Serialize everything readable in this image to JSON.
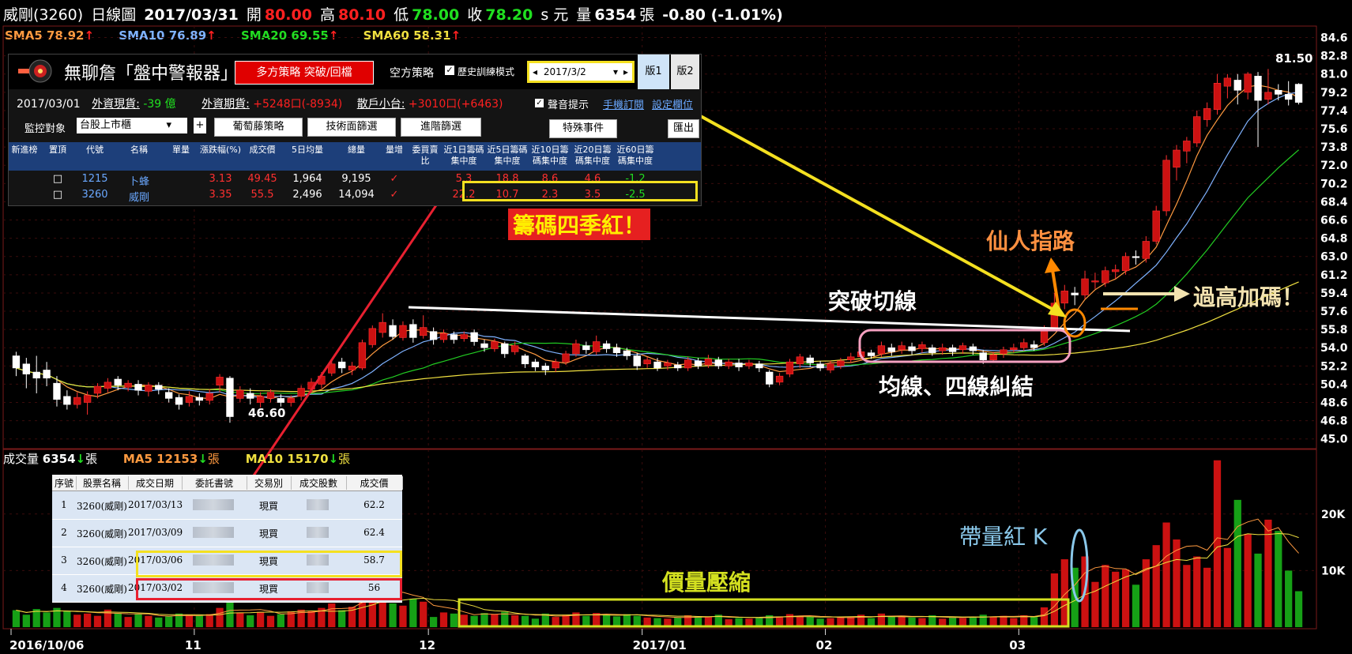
{
  "header": {
    "stock": "威剛(3260)",
    "period": "日線圖",
    "date": "2017/03/31",
    "open_label": "開",
    "open": "80.00",
    "high_label": "高",
    "high": "80.10",
    "low_label": "低",
    "low": "78.00",
    "close_label": "收",
    "close": "78.20",
    "unit": "s 元",
    "vol_label": "量",
    "vol": "6354",
    "vol_unit": "張",
    "change": "-0.80 (-1.01%)"
  },
  "sma": {
    "sma5": "SMA5 78.92",
    "sma10": "SMA10 76.89",
    "sma20": "SMA20 69.55",
    "sma60": "SMA60 58.31",
    "arrow": "↑"
  },
  "volume_bar": {
    "label": "成交量",
    "value": "6354",
    "unit": "張",
    "ma5": "MA5 12153",
    "ma10": "MA10 15170",
    "arrow": "↓"
  },
  "panel": {
    "title": "無聊詹「盤中警報器」",
    "long_btn": "多方策略 突破/回檔",
    "short_label": "空方策略",
    "history_label": "歷史訓練模式",
    "date_value": "2017/3/2",
    "tab1": "版1",
    "tab2": "版2",
    "date": "2017/03/01",
    "foreign_spot_label": "外資現貨:",
    "foreign_spot": "-39 億",
    "foreign_fut_label": "外資期貨:",
    "foreign_fut": "+5248口(-8934)",
    "retail_label": "散戶小台:",
    "retail": "+3010口(+6463)",
    "sound_label": "聲音提示",
    "mobile_link": "手機訂閱",
    "settings_link": "設定欄位",
    "monitor_label": "監控對象",
    "monitor_value": "台股上市櫃",
    "btn_grape": "葡萄藤策略",
    "btn_tech": "技術面篩選",
    "btn_adv": "進階篩選",
    "btn_special": "特殊事件",
    "btn_export": "匯出",
    "columns": [
      "新進榜",
      "置頂",
      "代號",
      "名稱",
      "單量",
      "漲跌幅(%)",
      "成交價",
      "5日均量",
      "總量",
      "量增",
      "委買賣比",
      "近1日籌碼集中度",
      "近5日籌碼集中度",
      "近10日籌碼集中度",
      "近20日籌碼集中度",
      "近60日籌碼集中度"
    ],
    "rows": [
      {
        "code": "1215",
        "name": "卜蜂",
        "chg": "3.13",
        "price": "49.45",
        "avg5": "1,964",
        "total": "9,195",
        "c1": "5.3",
        "c5": "18.8",
        "c10": "8.6",
        "c20": "4.6",
        "c60": "-1.2"
      },
      {
        "code": "3260",
        "name": "威剛",
        "chg": "3.35",
        "price": "55.5",
        "avg5": "2,496",
        "total": "14,094",
        "c1": "22.2",
        "c5": "10.7",
        "c10": "2.3",
        "c20": "3.5",
        "c60": "-2.5"
      }
    ],
    "check": "✓"
  },
  "trades": {
    "columns": [
      "序號",
      "股票名稱",
      "成交日期",
      "委託書號",
      "交易別",
      "成交股數",
      "成交價"
    ],
    "rows": [
      {
        "no": "1",
        "name": "3260(威剛)",
        "date": "2017/03/13",
        "type": "現買",
        "price": "62.2"
      },
      {
        "no": "2",
        "name": "3260(威剛)",
        "date": "2017/03/09",
        "type": "現買",
        "price": "62.4"
      },
      {
        "no": "3",
        "name": "3260(威剛)",
        "date": "2017/03/06",
        "type": "現買",
        "price": "58.7"
      },
      {
        "no": "4",
        "name": "3260(威剛)",
        "date": "2017/03/02",
        "type": "現買",
        "price": "56"
      }
    ]
  },
  "annotations": {
    "chips_red": "籌碼四季紅！",
    "guide": "仙人指路",
    "breakout": "突破切線",
    "add": "過高加碼！",
    "tangle": "均線、四線糾結",
    "volume_red_k": "帶量紅 K",
    "compress": "價量壓縮",
    "low_price": "46.60",
    "high_price": "81.50"
  },
  "chart_data": {
    "type": "candlestick",
    "price_axis": [
      "84.6",
      "82.8",
      "81.0",
      "79.2",
      "77.4",
      "75.6",
      "73.8",
      "72.0",
      "70.2",
      "68.4",
      "66.6",
      "64.8",
      "63.0",
      "61.2",
      "59.4",
      "57.6",
      "55.8",
      "54.0",
      "52.2",
      "50.4",
      "48.6",
      "46.8",
      "45.0"
    ],
    "ylim": [
      44.2,
      85.5
    ],
    "volume_axis": [
      {
        "label": "20K",
        "value": 20000
      },
      {
        "label": "10K",
        "value": 10000
      }
    ],
    "x_ticks": [
      {
        "label": "2016/10/06",
        "index": 0
      },
      {
        "label": "11",
        "index": 18
      },
      {
        "label": "12",
        "index": 41
      },
      {
        "label": "2017/01",
        "index": 62
      },
      {
        "label": "02",
        "index": 80
      },
      {
        "label": "03",
        "index": 99
      }
    ],
    "candles": [
      {
        "o": 53.2,
        "c": 52.0,
        "h": 53.6,
        "l": 51.2,
        "v": 3000
      },
      {
        "o": 52.4,
        "c": 51.4,
        "h": 53.0,
        "l": 50.0,
        "v": 2200
      },
      {
        "o": 51.6,
        "c": 51.0,
        "h": 53.2,
        "l": 49.5,
        "v": 3200
      },
      {
        "o": 51.8,
        "c": 51.0,
        "h": 52.6,
        "l": 50.2,
        "v": 2600
      },
      {
        "o": 50.5,
        "c": 48.9,
        "h": 51.2,
        "l": 48.2,
        "v": 3400
      },
      {
        "o": 49.2,
        "c": 48.4,
        "h": 49.8,
        "l": 47.9,
        "v": 2800
      },
      {
        "o": 48.4,
        "c": 49.1,
        "h": 49.6,
        "l": 48.0,
        "v": 2200
      },
      {
        "o": 48.6,
        "c": 49.3,
        "h": 49.7,
        "l": 47.4,
        "v": 2400
      },
      {
        "o": 49.5,
        "c": 50.2,
        "h": 50.5,
        "l": 49.0,
        "v": 2000
      },
      {
        "o": 50.0,
        "c": 50.6,
        "h": 51.0,
        "l": 49.6,
        "v": 3100
      },
      {
        "o": 50.9,
        "c": 50.3,
        "h": 51.2,
        "l": 49.8,
        "v": 2500
      },
      {
        "o": 50.1,
        "c": 50.5,
        "h": 50.8,
        "l": 49.7,
        "v": 1800
      },
      {
        "o": 50.4,
        "c": 49.8,
        "h": 50.8,
        "l": 49.3,
        "v": 2300
      },
      {
        "o": 49.7,
        "c": 50.3,
        "h": 50.6,
        "l": 49.2,
        "v": 2000
      },
      {
        "o": 50.3,
        "c": 49.9,
        "h": 50.6,
        "l": 49.4,
        "v": 1700
      },
      {
        "o": 49.6,
        "c": 49.0,
        "h": 50.0,
        "l": 48.6,
        "v": 1900
      },
      {
        "o": 49.1,
        "c": 48.4,
        "h": 49.4,
        "l": 47.9,
        "v": 2400
      },
      {
        "o": 48.6,
        "c": 49.2,
        "h": 49.7,
        "l": 48.2,
        "v": 2200
      },
      {
        "o": 49.1,
        "c": 48.8,
        "h": 49.5,
        "l": 48.3,
        "v": 2000
      },
      {
        "o": 48.8,
        "c": 49.5,
        "h": 49.9,
        "l": 48.4,
        "v": 2300
      },
      {
        "o": 50.3,
        "c": 51.1,
        "h": 51.4,
        "l": 49.6,
        "v": 3400
      },
      {
        "o": 51.0,
        "c": 47.2,
        "h": 51.2,
        "l": 46.6,
        "v": 4800
      },
      {
        "o": 49.0,
        "c": 49.8,
        "h": 50.2,
        "l": 48.6,
        "v": 2600
      },
      {
        "o": 49.5,
        "c": 49.0,
        "h": 50.0,
        "l": 48.4,
        "v": 2100
      },
      {
        "o": 48.6,
        "c": 49.2,
        "h": 49.6,
        "l": 48.1,
        "v": 2700
      },
      {
        "o": 49.0,
        "c": 49.6,
        "h": 49.9,
        "l": 48.6,
        "v": 2000
      },
      {
        "o": 49.0,
        "c": 48.6,
        "h": 49.4,
        "l": 48.2,
        "v": 2300
      },
      {
        "o": 48.6,
        "c": 49.0,
        "h": 49.3,
        "l": 48.2,
        "v": 2800
      },
      {
        "o": 49.2,
        "c": 50.0,
        "h": 50.3,
        "l": 48.8,
        "v": 3100
      },
      {
        "o": 49.9,
        "c": 50.6,
        "h": 51.0,
        "l": 49.6,
        "v": 2800
      },
      {
        "o": 50.4,
        "c": 51.2,
        "h": 51.6,
        "l": 50.0,
        "v": 3400
      },
      {
        "o": 51.5,
        "c": 52.4,
        "h": 52.8,
        "l": 51.2,
        "v": 4200
      },
      {
        "o": 52.6,
        "c": 52.0,
        "h": 53.0,
        "l": 51.5,
        "v": 3000
      },
      {
        "o": 51.8,
        "c": 52.2,
        "h": 52.6,
        "l": 51.3,
        "v": 3600
      },
      {
        "o": 52.0,
        "c": 54.5,
        "h": 54.8,
        "l": 51.8,
        "v": 7500
      },
      {
        "o": 54.3,
        "c": 55.9,
        "h": 56.2,
        "l": 54.0,
        "v": 6500
      },
      {
        "o": 55.5,
        "c": 56.5,
        "h": 57.4,
        "l": 55.0,
        "v": 8800
      },
      {
        "o": 56.2,
        "c": 55.1,
        "h": 56.8,
        "l": 54.8,
        "v": 4200
      },
      {
        "o": 55.0,
        "c": 56.2,
        "h": 56.6,
        "l": 54.7,
        "v": 3800
      },
      {
        "o": 56.3,
        "c": 55.0,
        "h": 56.8,
        "l": 54.5,
        "v": 5000
      },
      {
        "o": 55.2,
        "c": 56.0,
        "h": 57.2,
        "l": 54.9,
        "v": 4500
      },
      {
        "o": 55.6,
        "c": 54.8,
        "h": 56.0,
        "l": 54.3,
        "v": 1800
      },
      {
        "o": 54.8,
        "c": 55.4,
        "h": 55.8,
        "l": 54.5,
        "v": 2600
      },
      {
        "o": 55.3,
        "c": 54.8,
        "h": 55.6,
        "l": 54.4,
        "v": 2400
      },
      {
        "o": 54.9,
        "c": 55.3,
        "h": 55.6,
        "l": 54.6,
        "v": 2200
      },
      {
        "o": 55.5,
        "c": 54.6,
        "h": 55.8,
        "l": 54.2,
        "v": 2000
      },
      {
        "o": 54.4,
        "c": 54.0,
        "h": 54.8,
        "l": 53.6,
        "v": 2500
      },
      {
        "o": 53.9,
        "c": 54.6,
        "h": 54.9,
        "l": 53.6,
        "v": 2300
      },
      {
        "o": 54.4,
        "c": 53.4,
        "h": 54.6,
        "l": 53.0,
        "v": 2700
      },
      {
        "o": 53.6,
        "c": 54.2,
        "h": 54.6,
        "l": 53.3,
        "v": 2100
      },
      {
        "o": 53.2,
        "c": 52.4,
        "h": 53.4,
        "l": 52.0,
        "v": 2000
      },
      {
        "o": 52.6,
        "c": 52.1,
        "h": 52.9,
        "l": 51.7,
        "v": 1500
      },
      {
        "o": 52.2,
        "c": 51.8,
        "h": 52.5,
        "l": 51.3,
        "v": 2400
      },
      {
        "o": 52.0,
        "c": 52.6,
        "h": 52.9,
        "l": 51.6,
        "v": 1800
      },
      {
        "o": 52.6,
        "c": 53.4,
        "h": 53.7,
        "l": 52.3,
        "v": 2200
      },
      {
        "o": 53.4,
        "c": 54.4,
        "h": 54.8,
        "l": 53.1,
        "v": 2600
      },
      {
        "o": 54.2,
        "c": 53.8,
        "h": 54.6,
        "l": 53.4,
        "v": 2000
      },
      {
        "o": 53.6,
        "c": 54.6,
        "h": 55.2,
        "l": 53.3,
        "v": 2500
      },
      {
        "o": 54.4,
        "c": 53.9,
        "h": 54.7,
        "l": 53.5,
        "v": 2200
      },
      {
        "o": 54.0,
        "c": 53.5,
        "h": 54.4,
        "l": 53.1,
        "v": 1900
      },
      {
        "o": 53.7,
        "c": 53.2,
        "h": 54.0,
        "l": 52.8,
        "v": 2300
      },
      {
        "o": 53.2,
        "c": 52.2,
        "h": 53.5,
        "l": 51.8,
        "v": 2000
      },
      {
        "o": 52.4,
        "c": 52.8,
        "h": 53.1,
        "l": 52.0,
        "v": 1700
      },
      {
        "o": 52.6,
        "c": 52.0,
        "h": 53.0,
        "l": 51.7,
        "v": 1600
      },
      {
        "o": 52.2,
        "c": 52.5,
        "h": 52.8,
        "l": 51.8,
        "v": 1500
      },
      {
        "o": 52.3,
        "c": 52.0,
        "h": 52.6,
        "l": 51.7,
        "v": 1700
      },
      {
        "o": 52.0,
        "c": 52.8,
        "h": 53.1,
        "l": 51.7,
        "v": 2100
      },
      {
        "o": 52.7,
        "c": 52.2,
        "h": 53.0,
        "l": 51.9,
        "v": 1900
      },
      {
        "o": 52.3,
        "c": 52.9,
        "h": 53.3,
        "l": 52.0,
        "v": 1800
      },
      {
        "o": 52.8,
        "c": 52.2,
        "h": 53.1,
        "l": 51.9,
        "v": 2200
      },
      {
        "o": 52.2,
        "c": 52.6,
        "h": 52.9,
        "l": 51.9,
        "v": 1400
      },
      {
        "o": 52.5,
        "c": 52.1,
        "h": 52.9,
        "l": 51.7,
        "v": 1600
      },
      {
        "o": 52.2,
        "c": 52.5,
        "h": 52.8,
        "l": 51.9,
        "v": 1500
      },
      {
        "o": 52.4,
        "c": 52.0,
        "h": 52.7,
        "l": 51.6,
        "v": 1700
      },
      {
        "o": 51.6,
        "c": 50.4,
        "h": 51.8,
        "l": 50.1,
        "v": 2100
      },
      {
        "o": 50.6,
        "c": 51.2,
        "h": 51.5,
        "l": 50.3,
        "v": 1900
      },
      {
        "o": 51.4,
        "c": 52.6,
        "h": 52.9,
        "l": 51.1,
        "v": 2300
      },
      {
        "o": 52.4,
        "c": 53.1,
        "h": 53.4,
        "l": 52.0,
        "v": 2000
      },
      {
        "o": 53.0,
        "c": 52.5,
        "h": 53.3,
        "l": 52.1,
        "v": 1800
      },
      {
        "o": 52.4,
        "c": 52.0,
        "h": 52.7,
        "l": 51.7,
        "v": 1500
      },
      {
        "o": 51.8,
        "c": 52.4,
        "h": 52.7,
        "l": 51.5,
        "v": 1600
      },
      {
        "o": 52.2,
        "c": 52.7,
        "h": 53.0,
        "l": 51.9,
        "v": 1700
      },
      {
        "o": 52.8,
        "c": 53.1,
        "h": 53.5,
        "l": 52.5,
        "v": 1800
      },
      {
        "o": 53.1,
        "c": 53.6,
        "h": 53.9,
        "l": 52.8,
        "v": 2200
      },
      {
        "o": 53.5,
        "c": 53.2,
        "h": 53.8,
        "l": 52.9,
        "v": 1600
      },
      {
        "o": 53.4,
        "c": 54.2,
        "h": 54.6,
        "l": 53.1,
        "v": 2400
      },
      {
        "o": 54.0,
        "c": 53.6,
        "h": 54.4,
        "l": 53.2,
        "v": 1800
      },
      {
        "o": 53.8,
        "c": 54.2,
        "h": 54.6,
        "l": 53.4,
        "v": 2000
      },
      {
        "o": 54.1,
        "c": 53.7,
        "h": 54.5,
        "l": 53.3,
        "v": 1700
      },
      {
        "o": 53.9,
        "c": 54.3,
        "h": 54.6,
        "l": 53.5,
        "v": 1600
      },
      {
        "o": 54.0,
        "c": 53.5,
        "h": 54.3,
        "l": 53.2,
        "v": 2100
      },
      {
        "o": 53.7,
        "c": 54.0,
        "h": 54.4,
        "l": 53.3,
        "v": 1500
      },
      {
        "o": 54.0,
        "c": 53.6,
        "h": 54.3,
        "l": 53.2,
        "v": 1700
      },
      {
        "o": 53.8,
        "c": 54.2,
        "h": 54.5,
        "l": 53.4,
        "v": 1600
      },
      {
        "o": 54.1,
        "c": 53.7,
        "h": 54.4,
        "l": 53.3,
        "v": 1800
      },
      {
        "o": 53.5,
        "c": 52.8,
        "h": 53.8,
        "l": 52.4,
        "v": 2200
      },
      {
        "o": 52.8,
        "c": 53.3,
        "h": 53.6,
        "l": 52.5,
        "v": 1900
      },
      {
        "o": 53.4,
        "c": 53.8,
        "h": 54.1,
        "l": 53.0,
        "v": 2000
      },
      {
        "o": 53.8,
        "c": 54.0,
        "h": 54.4,
        "l": 53.5,
        "v": 1600
      },
      {
        "o": 54.0,
        "c": 54.5,
        "h": 54.9,
        "l": 53.7,
        "v": 2100
      },
      {
        "o": 54.3,
        "c": 54.0,
        "h": 54.7,
        "l": 53.7,
        "v": 1800
      },
      {
        "o": 54.5,
        "c": 55.8,
        "h": 56.2,
        "l": 54.2,
        "v": 3500
      },
      {
        "o": 56.0,
        "c": 58.4,
        "h": 59.4,
        "l": 55.8,
        "v": 9500
      },
      {
        "o": 58.4,
        "c": 59.6,
        "h": 60.2,
        "l": 57.8,
        "v": 12000
      },
      {
        "o": 59.4,
        "c": 59.2,
        "h": 60.0,
        "l": 58.2,
        "v": 10500
      },
      {
        "o": 59.2,
        "c": 60.8,
        "h": 61.6,
        "l": 58.8,
        "v": 12500
      },
      {
        "o": 60.6,
        "c": 60.6,
        "h": 61.4,
        "l": 59.8,
        "v": 8000
      },
      {
        "o": 60.4,
        "c": 61.6,
        "h": 62.0,
        "l": 60.0,
        "v": 11000
      },
      {
        "o": 61.5,
        "c": 61.7,
        "h": 62.2,
        "l": 60.8,
        "v": 9800
      },
      {
        "o": 61.6,
        "c": 63.0,
        "h": 63.4,
        "l": 61.2,
        "v": 10200
      },
      {
        "o": 63.0,
        "c": 62.9,
        "h": 63.6,
        "l": 62.2,
        "v": 7500
      },
      {
        "o": 62.8,
        "c": 64.5,
        "h": 65.0,
        "l": 62.4,
        "v": 12000
      },
      {
        "o": 64.5,
        "c": 67.5,
        "h": 68.0,
        "l": 64.2,
        "v": 14500
      },
      {
        "o": 67.5,
        "c": 72.5,
        "h": 73.0,
        "l": 67.0,
        "v": 18500
      },
      {
        "o": 71.8,
        "c": 73.5,
        "h": 74.0,
        "l": 70.5,
        "v": 15500
      },
      {
        "o": 73.4,
        "c": 74.4,
        "h": 74.8,
        "l": 72.2,
        "v": 11000
      },
      {
        "o": 74.2,
        "c": 76.8,
        "h": 77.4,
        "l": 73.8,
        "v": 12500
      },
      {
        "o": 76.5,
        "c": 77.6,
        "h": 78.2,
        "l": 75.8,
        "v": 10500
      },
      {
        "o": 77.5,
        "c": 80.1,
        "h": 81.0,
        "l": 77.0,
        "v": 29500
      },
      {
        "o": 79.8,
        "c": 80.6,
        "h": 81.0,
        "l": 78.6,
        "v": 14000
      },
      {
        "o": 80.4,
        "c": 79.4,
        "h": 81.0,
        "l": 78.0,
        "v": 22500
      },
      {
        "o": 79.2,
        "c": 81.0,
        "h": 81.2,
        "l": 78.5,
        "v": 16500
      },
      {
        "o": 80.8,
        "c": 78.4,
        "h": 81.2,
        "l": 73.8,
        "v": 13000
      },
      {
        "o": 78.5,
        "c": 79.2,
        "h": 81.5,
        "l": 78.0,
        "v": 19000
      },
      {
        "o": 79.4,
        "c": 79.0,
        "h": 80.0,
        "l": 78.4,
        "v": 17000
      },
      {
        "o": 79.0,
        "c": 78.5,
        "h": 80.3,
        "l": 77.9,
        "v": 10000
      },
      {
        "o": 80.0,
        "c": 78.2,
        "h": 80.1,
        "l": 78.0,
        "v": 6354
      }
    ],
    "colors": {
      "up": "#cc1111",
      "down": "#16a016",
      "sma5": "#ff9a40",
      "sma10": "#7fb2ff",
      "sma20": "#22cc22",
      "sma60": "#f0e040"
    }
  }
}
